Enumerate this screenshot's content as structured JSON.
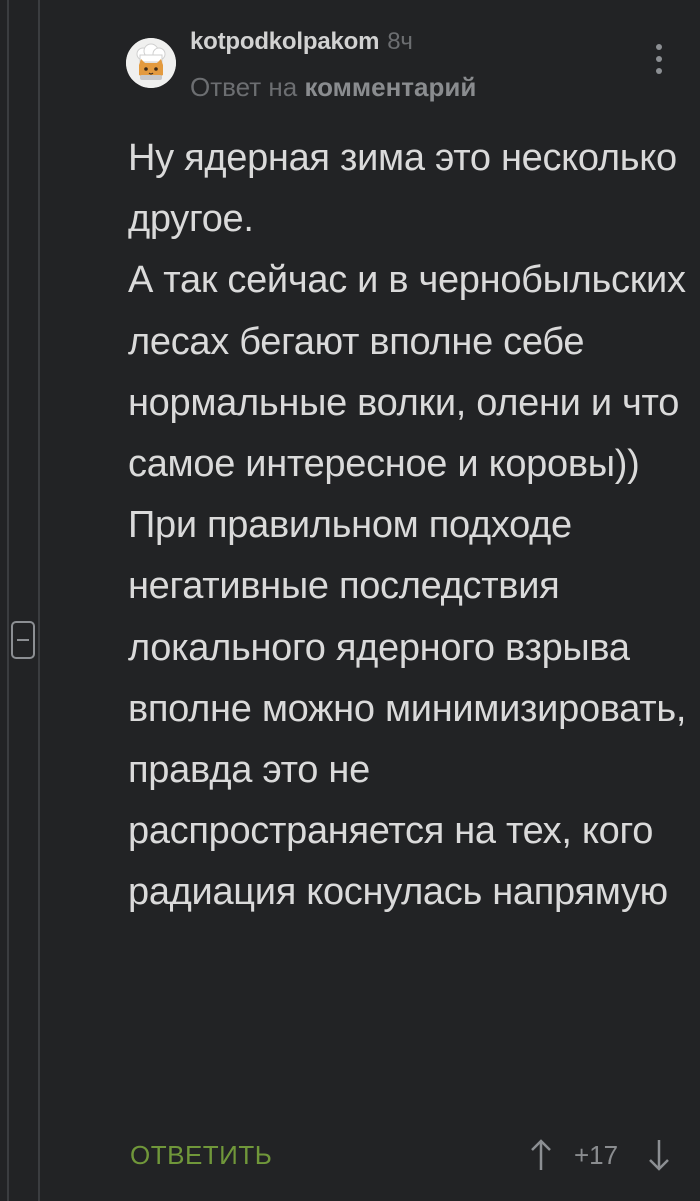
{
  "comment": {
    "author": "kotpodkolpakom",
    "time": "8ч",
    "reply_prefix": "Ответ на",
    "reply_target": "комментарий",
    "text": "Ну ядерная зима это несколько другое.\nА так сейчас и в чернобыльских лесах бегают вполне себе нормальные волки, олени и что самое интересное и коровы))\n При правильном подходе негативные последствия локального ядерного взрыва вполне можно минимизировать, правда это не распространяется на тех, кого радиация коснулась напрямую",
    "reply_label": "ОТВЕТИТЬ",
    "rating": "+17"
  },
  "icons": {
    "avatar": "chef-cat-avatar",
    "more": "more-vertical-icon",
    "upvote": "arrow-up-icon",
    "downvote": "arrow-down-icon",
    "collapse": "collapse-thread-icon"
  },
  "colors": {
    "background": "#222325",
    "text": "#dadada",
    "muted": "#6c6e71",
    "accent_green": "#70973a",
    "thread_line": "#3b3d40"
  }
}
